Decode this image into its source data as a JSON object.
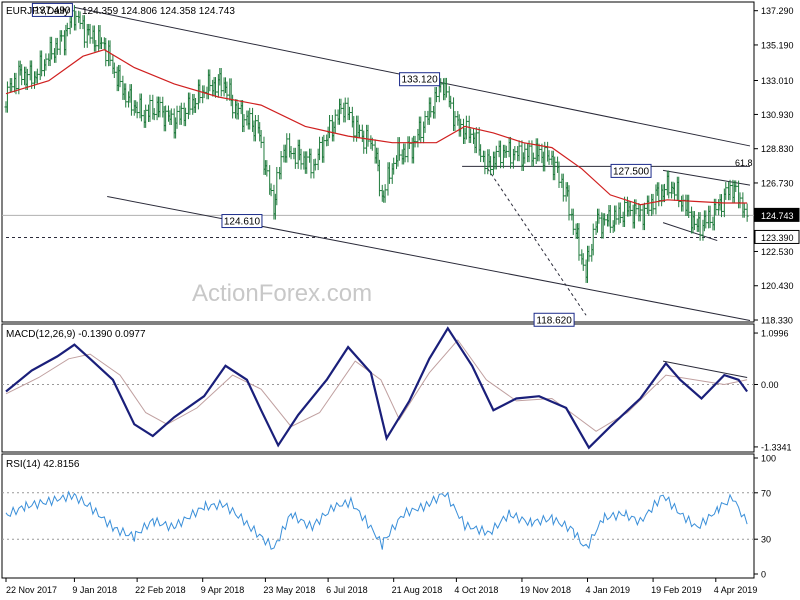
{
  "header": {
    "symbol_label": "EURJPY,Daily",
    "ohlc_label": "124.359 124.806 124.358 124.743"
  },
  "watermark": "ActionForex.com",
  "colors": {
    "price": "#1f7a3c",
    "ma": "#d02020",
    "trendline": "#2b2b3a",
    "macd_main": "#1a1f7a",
    "macd_signal": "#c0a0a0",
    "rsi": "#3a8fd9",
    "label_border": "#1a2a8a"
  },
  "chart_data": [
    {
      "type": "candlestick",
      "title": "EURJPY,Daily",
      "y_ticks": [
        "137.290",
        "135.190",
        "133.010",
        "130.930",
        "128.830",
        "126.730",
        "124.743",
        "123.390",
        "122.530",
        "120.430",
        "118.330"
      ],
      "ylim": [
        118.33,
        137.7
      ],
      "current_price": 124.743,
      "support_level": 123.39,
      "fib_level": {
        "label": "61.8",
        "value": 127.6
      },
      "annotations": [
        {
          "text": "137.490",
          "date": "2018-01-09",
          "value": 137.49
        },
        {
          "text": "133.120",
          "date": "2018-09-25",
          "value": 133.12
        },
        {
          "text": "124.610",
          "date": "2018-05-29",
          "value": 124.61
        },
        {
          "text": "127.500",
          "date": "2019-02-26",
          "value": 127.5
        },
        {
          "text": "118.620",
          "date": "2019-01-03",
          "value": 118.62
        }
      ],
      "series": [
        {
          "name": "",
          "kind": "close",
          "points": [
            [
              "2017-11-22",
              132.1
            ],
            [
              "2017-12-01",
              133.4
            ],
            [
              "2017-12-12",
              133.2
            ],
            [
              "2017-12-22",
              134.5
            ],
            [
              "2018-01-02",
              135.6
            ],
            [
              "2018-01-09",
              137.1
            ],
            [
              "2018-01-18",
              135.9
            ],
            [
              "2018-01-30",
              135.2
            ],
            [
              "2018-02-08",
              133.2
            ],
            [
              "2018-02-16",
              131.9
            ],
            [
              "2018-02-27",
              130.9
            ],
            [
              "2018-03-08",
              131.4
            ],
            [
              "2018-03-20",
              130.4
            ],
            [
              "2018-04-02",
              131.6
            ],
            [
              "2018-04-12",
              132.6
            ],
            [
              "2018-04-24",
              132.9
            ],
            [
              "2018-05-02",
              131.3
            ],
            [
              "2018-05-10",
              130.6
            ],
            [
              "2018-05-18",
              130.1
            ],
            [
              "2018-05-29",
              125.3
            ],
            [
              "2018-06-05",
              128.9
            ],
            [
              "2018-06-15",
              128.4
            ],
            [
              "2018-06-26",
              127.8
            ],
            [
              "2018-07-05",
              129.5
            ],
            [
              "2018-07-17",
              131.5
            ],
            [
              "2018-07-26",
              130.0
            ],
            [
              "2018-08-08",
              128.9
            ],
            [
              "2018-08-13",
              125.8
            ],
            [
              "2018-08-23",
              128.4
            ],
            [
              "2018-09-03",
              128.9
            ],
            [
              "2018-09-14",
              130.8
            ],
            [
              "2018-09-25",
              132.9
            ],
            [
              "2018-10-05",
              130.2
            ],
            [
              "2018-10-16",
              129.6
            ],
            [
              "2018-10-26",
              127.8
            ],
            [
              "2018-11-06",
              128.7
            ],
            [
              "2018-11-19",
              128.4
            ],
            [
              "2018-11-29",
              128.6
            ],
            [
              "2018-12-10",
              128.2
            ],
            [
              "2018-12-20",
              126.2
            ],
            [
              "2019-01-03",
              121.2
            ],
            [
              "2019-01-10",
              124.3
            ],
            [
              "2019-01-22",
              124.5
            ],
            [
              "2019-02-01",
              125.1
            ],
            [
              "2019-02-12",
              124.8
            ],
            [
              "2019-02-21",
              125.9
            ],
            [
              "2019-03-04",
              126.6
            ],
            [
              "2019-03-14",
              125.3
            ],
            [
              "2019-03-22",
              124.0
            ],
            [
              "2019-04-02",
              124.7
            ],
            [
              "2019-04-10",
              125.9
            ],
            [
              "2019-04-16",
              126.5
            ],
            [
              "2019-04-23",
              125.4
            ],
            [
              "2019-04-26",
              124.7
            ]
          ]
        },
        {
          "name": "",
          "kind": "moving-average",
          "points": [
            [
              "2017-11-22",
              132.2
            ],
            [
              "2017-12-22",
              133.0
            ],
            [
              "2018-01-15",
              134.5
            ],
            [
              "2018-01-30",
              134.9
            ],
            [
              "2018-02-20",
              133.8
            ],
            [
              "2018-03-20",
              132.8
            ],
            [
              "2018-04-20",
              132.0
            ],
            [
              "2018-05-20",
              131.5
            ],
            [
              "2018-06-20",
              130.2
            ],
            [
              "2018-07-20",
              129.6
            ],
            [
              "2018-08-20",
              129.2
            ],
            [
              "2018-09-20",
              129.2
            ],
            [
              "2018-10-10",
              130.2
            ],
            [
              "2018-10-30",
              129.8
            ],
            [
              "2018-11-20",
              129.2
            ],
            [
              "2018-12-10",
              128.9
            ],
            [
              "2018-12-31",
              127.6
            ],
            [
              "2019-01-20",
              126.0
            ],
            [
              "2019-02-10",
              125.4
            ],
            [
              "2019-03-01",
              125.7
            ],
            [
              "2019-03-20",
              125.6
            ],
            [
              "2019-04-10",
              125.5
            ],
            [
              "2019-04-26",
              125.5
            ]
          ]
        }
      ],
      "trendlines": [
        {
          "style": "solid",
          "from": [
            "2018-01-09",
            137.49
          ],
          "to": [
            "2019-04-28",
            129.0
          ]
        },
        {
          "style": "solid",
          "from": [
            "2018-02-01",
            125.9
          ],
          "to": [
            "2019-04-28",
            118.3
          ]
        },
        {
          "style": "solid",
          "from": [
            "2018-10-08",
            127.75
          ],
          "to": [
            "2019-04-28",
            127.75
          ]
        },
        {
          "style": "solid",
          "from": [
            "2019-02-26",
            127.5
          ],
          "to": [
            "2019-04-28",
            126.6
          ]
        },
        {
          "style": "solid",
          "from": [
            "2019-02-26",
            124.3
          ],
          "to": [
            "2019-04-05",
            123.2
          ]
        },
        {
          "style": "dashed",
          "from": [
            "2018-10-26",
            127.6
          ],
          "to": [
            "2019-01-03",
            118.62
          ]
        },
        {
          "style": "dashed",
          "from": [
            "2017-11-22",
            123.39
          ],
          "to": [
            "2019-04-28",
            123.39
          ]
        }
      ]
    },
    {
      "type": "line",
      "title": "MACD(12,26,9) -0.1390 0.0977",
      "y_ticks": [
        "1.0996",
        "0.00",
        "-1.3341"
      ],
      "ylim": [
        -1.4,
        1.25
      ],
      "series": [
        {
          "name": "",
          "points": [
            [
              "2017-11-22",
              -0.15
            ],
            [
              "2017-12-10",
              0.3
            ],
            [
              "2017-12-28",
              0.6
            ],
            [
              "2018-01-09",
              0.85
            ],
            [
              "2018-01-20",
              0.55
            ],
            [
              "2018-02-05",
              0.1
            ],
            [
              "2018-02-20",
              -0.85
            ],
            [
              "2018-03-05",
              -1.1
            ],
            [
              "2018-03-20",
              -0.7
            ],
            [
              "2018-04-10",
              -0.25
            ],
            [
              "2018-04-25",
              0.4
            ],
            [
              "2018-05-10",
              0.1
            ],
            [
              "2018-05-20",
              -0.55
            ],
            [
              "2018-06-01",
              -1.3
            ],
            [
              "2018-06-15",
              -0.65
            ],
            [
              "2018-07-05",
              0.1
            ],
            [
              "2018-07-20",
              0.8
            ],
            [
              "2018-08-05",
              0.25
            ],
            [
              "2018-08-16",
              -1.15
            ],
            [
              "2018-09-01",
              -0.35
            ],
            [
              "2018-09-15",
              0.55
            ],
            [
              "2018-09-28",
              1.2
            ],
            [
              "2018-10-15",
              0.4
            ],
            [
              "2018-10-30",
              -0.55
            ],
            [
              "2018-11-15",
              -0.3
            ],
            [
              "2018-12-01",
              -0.25
            ],
            [
              "2018-12-20",
              -0.5
            ],
            [
              "2019-01-05",
              -1.35
            ],
            [
              "2019-01-20",
              -0.9
            ],
            [
              "2019-02-10",
              -0.3
            ],
            [
              "2019-02-28",
              0.45
            ],
            [
              "2019-03-10",
              0.1
            ],
            [
              "2019-03-25",
              -0.3
            ],
            [
              "2019-04-10",
              0.2
            ],
            [
              "2019-04-20",
              0.1
            ],
            [
              "2019-04-26",
              -0.15
            ]
          ]
        },
        {
          "name": "",
          "points": [
            [
              "2017-11-22",
              -0.2
            ],
            [
              "2017-12-15",
              0.15
            ],
            [
              "2018-01-05",
              0.55
            ],
            [
              "2018-01-20",
              0.65
            ],
            [
              "2018-02-10",
              0.2
            ],
            [
              "2018-02-28",
              -0.6
            ],
            [
              "2018-03-15",
              -0.85
            ],
            [
              "2018-04-05",
              -0.5
            ],
            [
              "2018-04-30",
              0.2
            ],
            [
              "2018-05-20",
              -0.1
            ],
            [
              "2018-06-10",
              -0.9
            ],
            [
              "2018-06-30",
              -0.6
            ],
            [
              "2018-07-25",
              0.5
            ],
            [
              "2018-08-12",
              0.1
            ],
            [
              "2018-08-25",
              -0.75
            ],
            [
              "2018-09-15",
              0.25
            ],
            [
              "2018-10-05",
              0.95
            ],
            [
              "2018-10-25",
              0.1
            ],
            [
              "2018-11-15",
              -0.35
            ],
            [
              "2018-12-10",
              -0.3
            ],
            [
              "2019-01-10",
              -1.0
            ],
            [
              "2019-02-01",
              -0.6
            ],
            [
              "2019-02-28",
              0.2
            ],
            [
              "2019-03-20",
              0.1
            ],
            [
              "2019-04-10",
              0.0
            ],
            [
              "2019-04-26",
              0.1
            ]
          ]
        }
      ],
      "trendlines": [
        {
          "style": "solid",
          "from": [
            "2019-02-26",
            0.5
          ],
          "to": [
            "2019-04-26",
            0.15
          ]
        }
      ]
    },
    {
      "type": "line",
      "title": "RSI(14) 42.8156",
      "y_ticks": [
        "100",
        "70",
        "30",
        "0"
      ],
      "ylim": [
        0,
        100
      ],
      "reference_lines": [
        70,
        30
      ],
      "x_ticks": [
        "22 Nov 2017",
        "9 Jan 2018",
        "22 Feb 2018",
        "9 Apr 2018",
        "23 May 2018",
        "6 Jul 2018",
        "21 Aug 2018",
        "4 Oct 2018",
        "19 Nov 2018",
        "4 Jan 2019",
        "19 Feb 2019",
        "4 Apr 2019"
      ],
      "series": [
        {
          "name": "",
          "points": [
            [
              "2017-11-22",
              50
            ],
            [
              "2017-12-05",
              58
            ],
            [
              "2017-12-20",
              62
            ],
            [
              "2018-01-09",
              68
            ],
            [
              "2018-01-20",
              58
            ],
            [
              "2018-02-05",
              40
            ],
            [
              "2018-02-20",
              32
            ],
            [
              "2018-03-05",
              46
            ],
            [
              "2018-03-20",
              40
            ],
            [
              "2018-04-10",
              58
            ],
            [
              "2018-04-25",
              60
            ],
            [
              "2018-05-10",
              44
            ],
            [
              "2018-05-29",
              22
            ],
            [
              "2018-06-10",
              52
            ],
            [
              "2018-06-25",
              40
            ],
            [
              "2018-07-10",
              58
            ],
            [
              "2018-07-22",
              62
            ],
            [
              "2018-08-05",
              40
            ],
            [
              "2018-08-13",
              25
            ],
            [
              "2018-08-28",
              52
            ],
            [
              "2018-09-15",
              60
            ],
            [
              "2018-09-26",
              70
            ],
            [
              "2018-10-10",
              42
            ],
            [
              "2018-10-28",
              35
            ],
            [
              "2018-11-10",
              52
            ],
            [
              "2018-11-25",
              44
            ],
            [
              "2018-12-10",
              48
            ],
            [
              "2018-12-25",
              38
            ],
            [
              "2019-01-03",
              22
            ],
            [
              "2019-01-15",
              48
            ],
            [
              "2019-01-30",
              52
            ],
            [
              "2019-02-10",
              45
            ],
            [
              "2019-02-26",
              68
            ],
            [
              "2019-03-10",
              52
            ],
            [
              "2019-03-22",
              40
            ],
            [
              "2019-04-05",
              55
            ],
            [
              "2019-04-16",
              66
            ],
            [
              "2019-04-22",
              52
            ],
            [
              "2019-04-26",
              43
            ]
          ]
        }
      ]
    }
  ]
}
